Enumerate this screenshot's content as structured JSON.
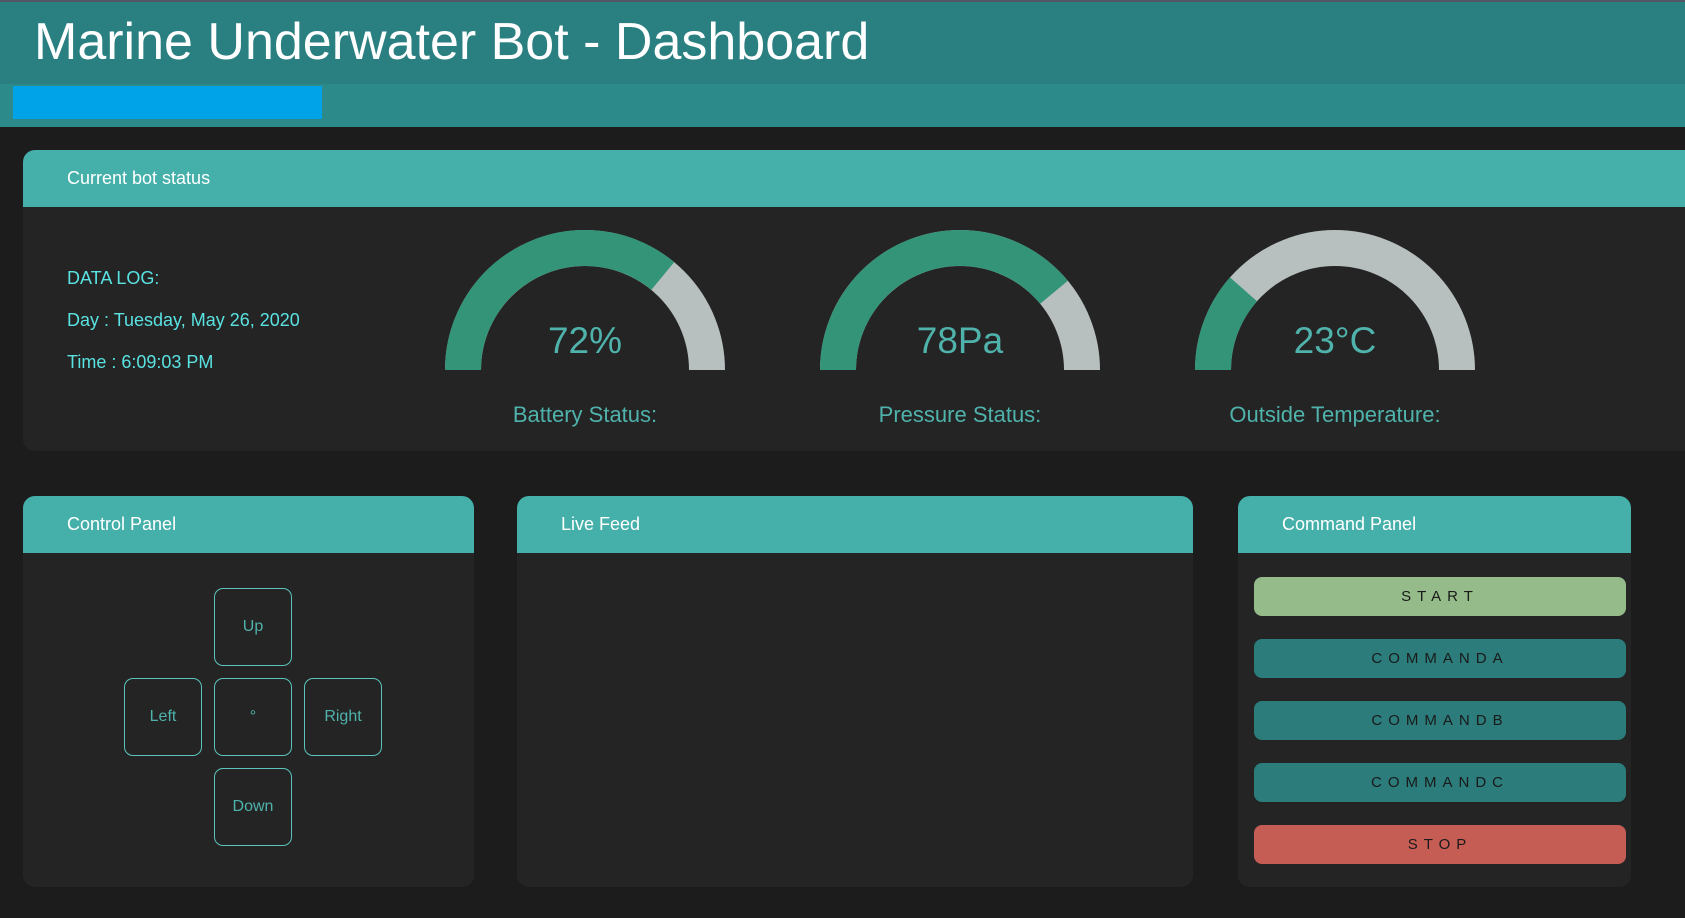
{
  "header": {
    "title": "Marine Underwater Bot - Dashboard"
  },
  "status": {
    "title": "Current bot status",
    "log": {
      "heading": "DATA LOG:",
      "day": "Day : Tuesday, May 26, 2020",
      "time": "Time : 6:09:03 PM"
    },
    "gauges": [
      {
        "value_text": "72%",
        "label": "Battery Status:",
        "fraction": 0.72
      },
      {
        "value_text": "78Pa",
        "label": "Pressure Status:",
        "fraction": 0.78
      },
      {
        "value_text": "23°C",
        "label": "Outside Temperature:",
        "fraction": 0.23
      }
    ]
  },
  "control": {
    "title": "Control Panel",
    "up": "Up",
    "left": "Left",
    "center": "°",
    "right": "Right",
    "down": "Down"
  },
  "feed": {
    "title": "Live Feed"
  },
  "command": {
    "title": "Command Panel",
    "start": "START",
    "command_a": "COMMANDA",
    "command_b": "COMMANDB",
    "command_c": "COMMANDC",
    "stop": "STOP"
  },
  "colors": {
    "header": "#2a7f80",
    "accent_bar": "#00a2e8",
    "card_header": "#45b0aa",
    "gauge_fill": "#339478",
    "gauge_track": "#b8bfbf",
    "start": "#96bb8a",
    "command": "#2b7c7b",
    "stop": "#c65d55"
  }
}
